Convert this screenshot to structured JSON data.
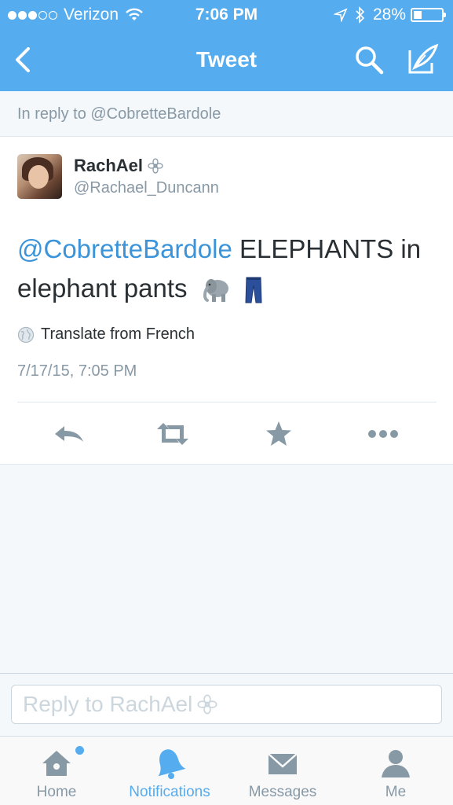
{
  "status_bar": {
    "carrier": "Verizon",
    "time": "7:06 PM",
    "battery": "28%",
    "battery_level": 0.28
  },
  "nav": {
    "title": "Tweet",
    "back_icon": "chevron-left-icon",
    "search_icon": "search-icon",
    "compose_icon": "compose-icon"
  },
  "reply_banner": {
    "text": "In reply to @CobretteBardole"
  },
  "tweet": {
    "author_name": "RachAel",
    "author_handle": "@Rachael_Duncann",
    "mention": "@CobretteBardole",
    "body": " ELEPHANTS in elephant pants",
    "translate_label": "Translate from French",
    "timestamp": "7/17/15, 7:05 PM",
    "actions": [
      "reply-icon",
      "retweet-icon",
      "favorite-icon",
      "more-icon"
    ]
  },
  "composer": {
    "placeholder": "Reply to RachAel"
  },
  "tabbar": {
    "tabs": [
      {
        "label": "Home",
        "icon": "home-icon",
        "active": false
      },
      {
        "label": "Notifications",
        "icon": "bell-icon",
        "active": true
      },
      {
        "label": "Messages",
        "icon": "envelope-icon",
        "active": false
      },
      {
        "label": "Me",
        "icon": "person-icon",
        "active": false
      }
    ]
  },
  "colors": {
    "brand": "#55acee",
    "link": "#3b94d9",
    "muted": "#8899a6",
    "text": "#292f33"
  }
}
